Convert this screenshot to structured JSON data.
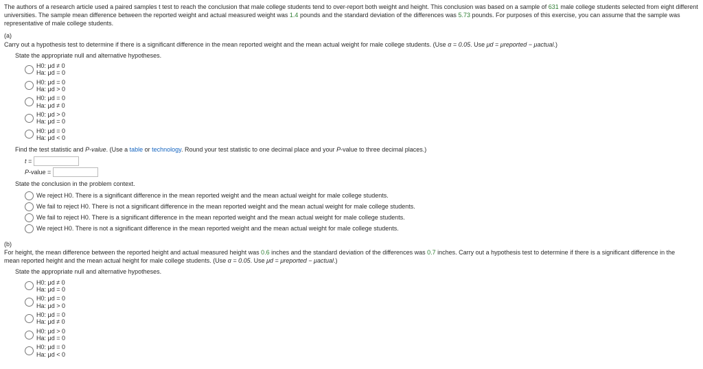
{
  "intro": {
    "t1": "The authors of a research article used a paired samples t test to reach the conclusion that male college students tend to over-report both weight and height. This conclusion was based on a sample of ",
    "n": "631",
    "t2": " male college students selected from eight different universities. The sample mean difference between the reported weight and actual measured weight was ",
    "diff": "1.4",
    "t3": " pounds and the standard deviation of the differences was ",
    "sd": "5.73",
    "t4": " pounds. For purposes of this exercise, you can assume that the sample was representative of male college students."
  },
  "a": {
    "label": "(a)",
    "prompt1": "Carry out a hypothesis test to determine if there is a significant difference in the mean reported weight and the mean actual weight for male college students. (Use ",
    "alpha": "α = 0.05",
    "prompt2": ". Use ",
    "mudef": "μd = μreported − μactual",
    "prompt3": ".)",
    "state_hyp": "State the appropriate null and alternative hypotheses.",
    "hyp": [
      {
        "h0": "H0: μd ≠ 0",
        "ha": "Ha: μd = 0"
      },
      {
        "h0": "H0: μd = 0",
        "ha": "Ha: μd > 0"
      },
      {
        "h0": "H0: μd = 0",
        "ha": "Ha: μd ≠ 0"
      },
      {
        "h0": "H0: μd > 0",
        "ha": "Ha: μd = 0"
      },
      {
        "h0": "H0: μd = 0",
        "ha": "Ha: μd < 0"
      }
    ],
    "findstat1": "Find the test statistic and ",
    "findstat_p": "P-value",
    "findstat2": ". (Use a ",
    "link_table": "table",
    "findstat3": " or ",
    "link_tech": "technology",
    "findstat4": ". Round your test statistic to one decimal place and your ",
    "findstat_p2": "P",
    "findstat5": "-value to three decimal places.)",
    "t_label": "t =",
    "p_label_i": "P",
    "p_label_rest": "-value =",
    "state_concl": "State the conclusion in the problem context.",
    "concl": [
      "We reject H0. There is a significant difference in the mean reported weight and the mean actual weight for male college students.",
      "We fail to reject H0. There is not a significant difference in the mean reported weight and the mean actual weight for male college students.",
      "We fail to reject H0. There is a significant difference in the mean reported weight and the mean actual weight for male college students.",
      "We reject H0. There is not a significant difference in the mean reported weight and the mean actual weight for male college students."
    ]
  },
  "b": {
    "label": "(b)",
    "t1": "For height, the mean difference between the reported height and actual measured height was ",
    "diff": "0.6",
    "t2": " inches and the standard deviation of the differences was ",
    "sd": "0.7",
    "t3": " inches. Carry out a hypothesis test to determine if there is a significant difference in the mean reported height and the mean actual height for male college students. (Use ",
    "alpha": "α = 0.05",
    "t4": ". Use ",
    "mudef": "μd = μreported − μactual",
    "t5": ".)",
    "state_hyp": "State the appropriate null and alternative hypotheses.",
    "hyp": [
      {
        "h0": "H0: μd ≠ 0",
        "ha": "Ha: μd = 0"
      },
      {
        "h0": "H0: μd = 0",
        "ha": "Ha: μd > 0"
      },
      {
        "h0": "H0: μd = 0",
        "ha": "Ha: μd ≠ 0"
      },
      {
        "h0": "H0: μd > 0",
        "ha": "Ha: μd = 0"
      },
      {
        "h0": "H0: μd = 0",
        "ha": "Ha: μd < 0"
      }
    ]
  }
}
